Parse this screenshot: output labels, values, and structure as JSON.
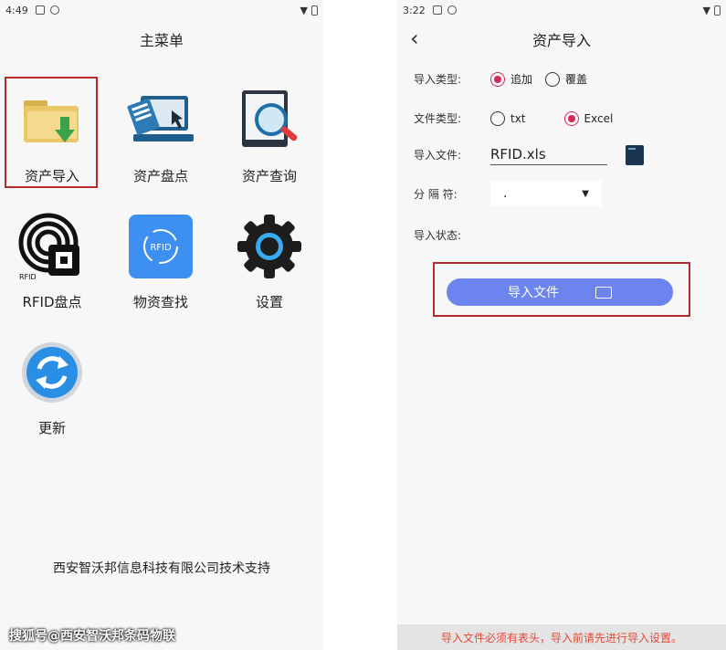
{
  "left": {
    "status_time": "4:49",
    "title": "主菜单",
    "menu": [
      {
        "label": "资产导入",
        "icon": "folder-import-icon"
      },
      {
        "label": "资产盘点",
        "icon": "inventory-laptop-icon"
      },
      {
        "label": "资产查询",
        "icon": "magnifier-search-icon"
      },
      {
        "label": "RFID盘点",
        "icon": "rfid-tag-icon"
      },
      {
        "label": "物资查找",
        "icon": "rfid-find-icon"
      },
      {
        "label": "设置",
        "icon": "gear-icon"
      },
      {
        "label": "更新",
        "icon": "refresh-icon"
      }
    ],
    "rfid_icon_text": "RFID",
    "rfid_find_icon_text": "RFID",
    "credit": "西安智沃邦信息科技有限公司技术支持"
  },
  "right": {
    "status_time": "3:22",
    "title": "资产导入",
    "import_type_label": "导入类型:",
    "import_type_options": [
      {
        "label": "追加",
        "selected": true
      },
      {
        "label": "覆盖",
        "selected": false
      }
    ],
    "file_type_label": "文件类型:",
    "file_type_options": [
      {
        "label": "txt",
        "selected": false
      },
      {
        "label": "Excel",
        "selected": true
      }
    ],
    "import_file_label": "导入文件:",
    "import_file_value": "RFID.xls",
    "separator_label": "分 隔 符:",
    "separator_value": ".",
    "import_status_label": "导入状态:",
    "import_button_label": "导入文件",
    "hint": "导入文件必须有表头，导入前请先进行导入设置。"
  },
  "watermark": "搜狐号@西安智沃邦条码物联",
  "colors": {
    "accent_radio": "#d42a57",
    "button": "#6b84ee",
    "highlight_box": "#b52a2a",
    "hint_text": "#e24a3a"
  }
}
